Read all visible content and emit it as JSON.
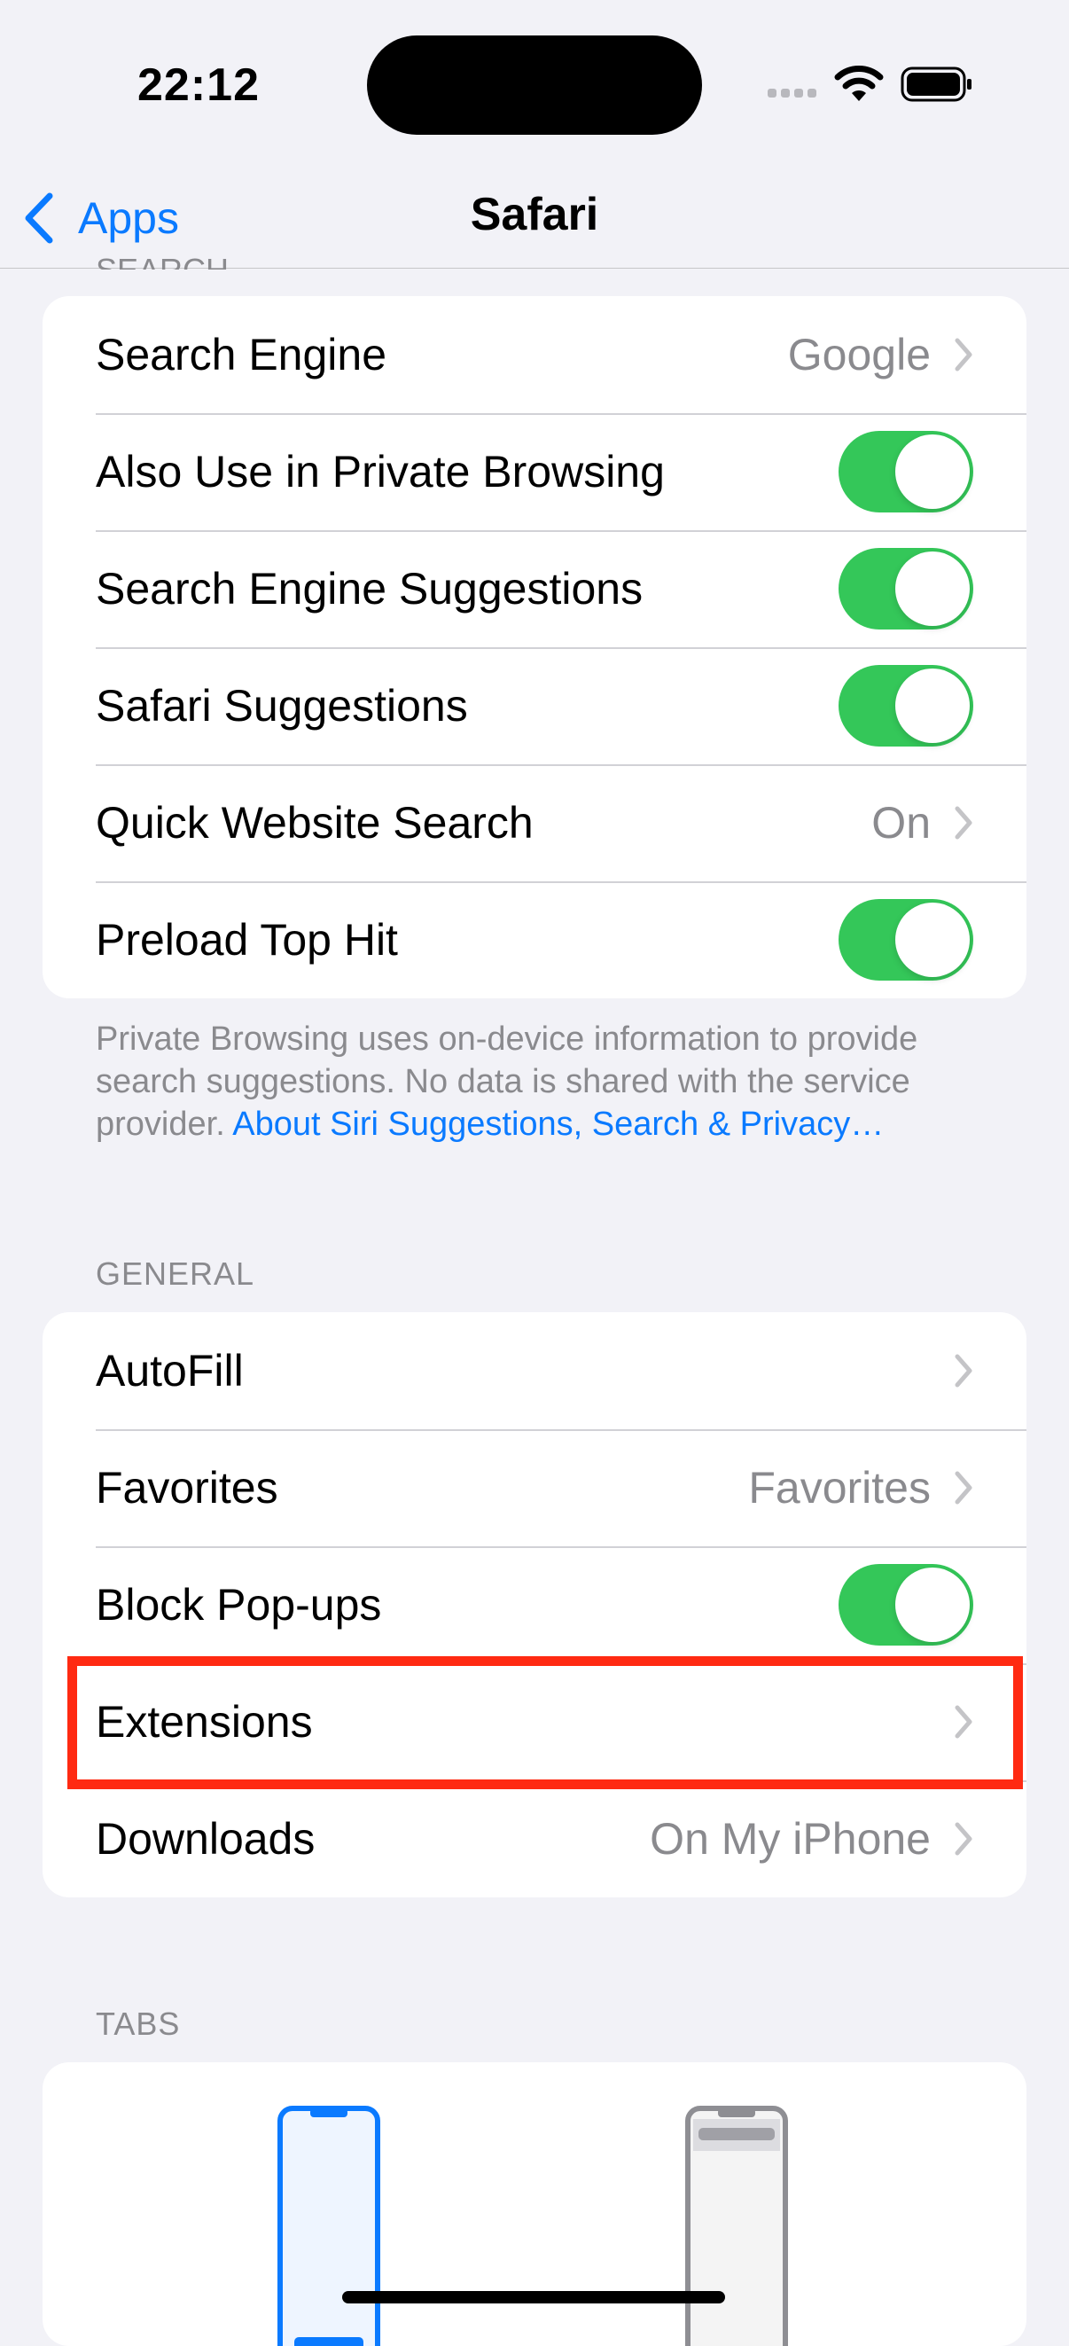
{
  "status_bar": {
    "time": "22:12",
    "icons": [
      "cellular-signal-icon",
      "wifi-icon",
      "battery-icon"
    ]
  },
  "nav": {
    "back_label": "Apps",
    "title": "Safari"
  },
  "search_section": {
    "header_partial": "SEARCH",
    "rows": [
      {
        "label": "Search Engine",
        "value": "Google",
        "control": "chevron"
      },
      {
        "label": "Also Use in Private Browsing",
        "control": "toggle",
        "on": true
      },
      {
        "label": "Search Engine Suggestions",
        "control": "toggle",
        "on": true
      },
      {
        "label": "Safari Suggestions",
        "control": "toggle",
        "on": true
      },
      {
        "label": "Quick Website Search",
        "value": "On",
        "control": "chevron"
      },
      {
        "label": "Preload Top Hit",
        "control": "toggle",
        "on": true
      }
    ],
    "footer_text": "Private Browsing uses on-device information to provide search suggestions. No data is shared with the service provider. ",
    "footer_link": "About Siri Suggestions, Search & Privacy…"
  },
  "general_section": {
    "header": "GENERAL",
    "rows": [
      {
        "label": "AutoFill",
        "control": "chevron"
      },
      {
        "label": "Favorites",
        "value": "Favorites",
        "control": "chevron"
      },
      {
        "label": "Block Pop-ups",
        "control": "toggle",
        "on": true
      },
      {
        "label": "Extensions",
        "control": "chevron",
        "highlighted": true
      },
      {
        "label": "Downloads",
        "value": "On My iPhone",
        "control": "chevron"
      }
    ]
  },
  "tabs_section": {
    "header": "TABS",
    "options": [
      "tab-bar-layout-icon",
      "single-tab-layout-icon"
    ]
  },
  "colors": {
    "accent": "#0a7aff",
    "toggle_on": "#34c759",
    "highlight_box": "#ff2a12",
    "background": "#f2f2f7",
    "secondary_text": "#8a8a8e"
  }
}
